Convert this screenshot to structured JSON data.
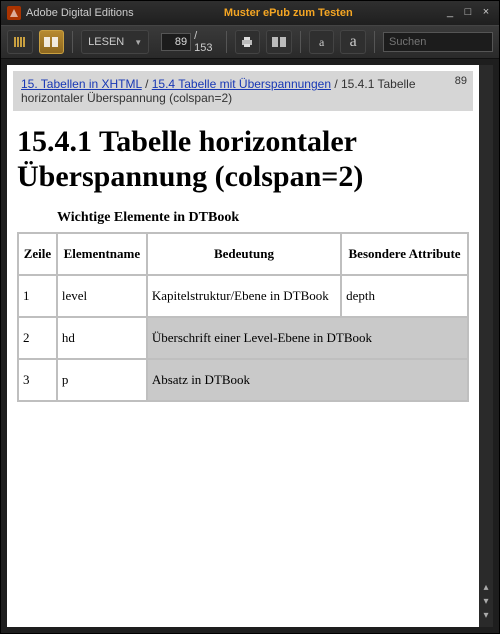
{
  "titlebar": {
    "app_name": "Adobe Digital Editions",
    "doc_title": "Muster ePub zum Testen"
  },
  "toolbar": {
    "read_label": "LESEN",
    "page_current": "89",
    "page_total": "/ 153",
    "search_placeholder": "Suchen"
  },
  "breadcrumb": {
    "a1": "15. Tabellen in XHTML",
    "sep1": " / ",
    "a2": "15.4 Tabelle mit Überspannungen",
    "tail": " / 15.4.1 Tabelle horizontaler Überspannung (colspan=2)",
    "page_no": "89"
  },
  "doc": {
    "h1": "15.4.1 Tabelle horizontaler Überspannung (colspan=2)",
    "caption": "Wichtige Elemente in DTBook",
    "headers": {
      "c1": "Zeile",
      "c2": "Elementname",
      "c3": "Bedeutung",
      "c4": "Besondere Attribute"
    },
    "rows": [
      {
        "n": "1",
        "name": "level",
        "meaning": "Kapitelstruktur/Ebene in DTBook",
        "attr": "depth",
        "span": false
      },
      {
        "n": "2",
        "name": "hd",
        "meaning": "Überschrift einer Level-Ebene in DTBook",
        "span": true
      },
      {
        "n": "3",
        "name": "p",
        "meaning": "Absatz in DTBook",
        "span": true
      }
    ]
  }
}
